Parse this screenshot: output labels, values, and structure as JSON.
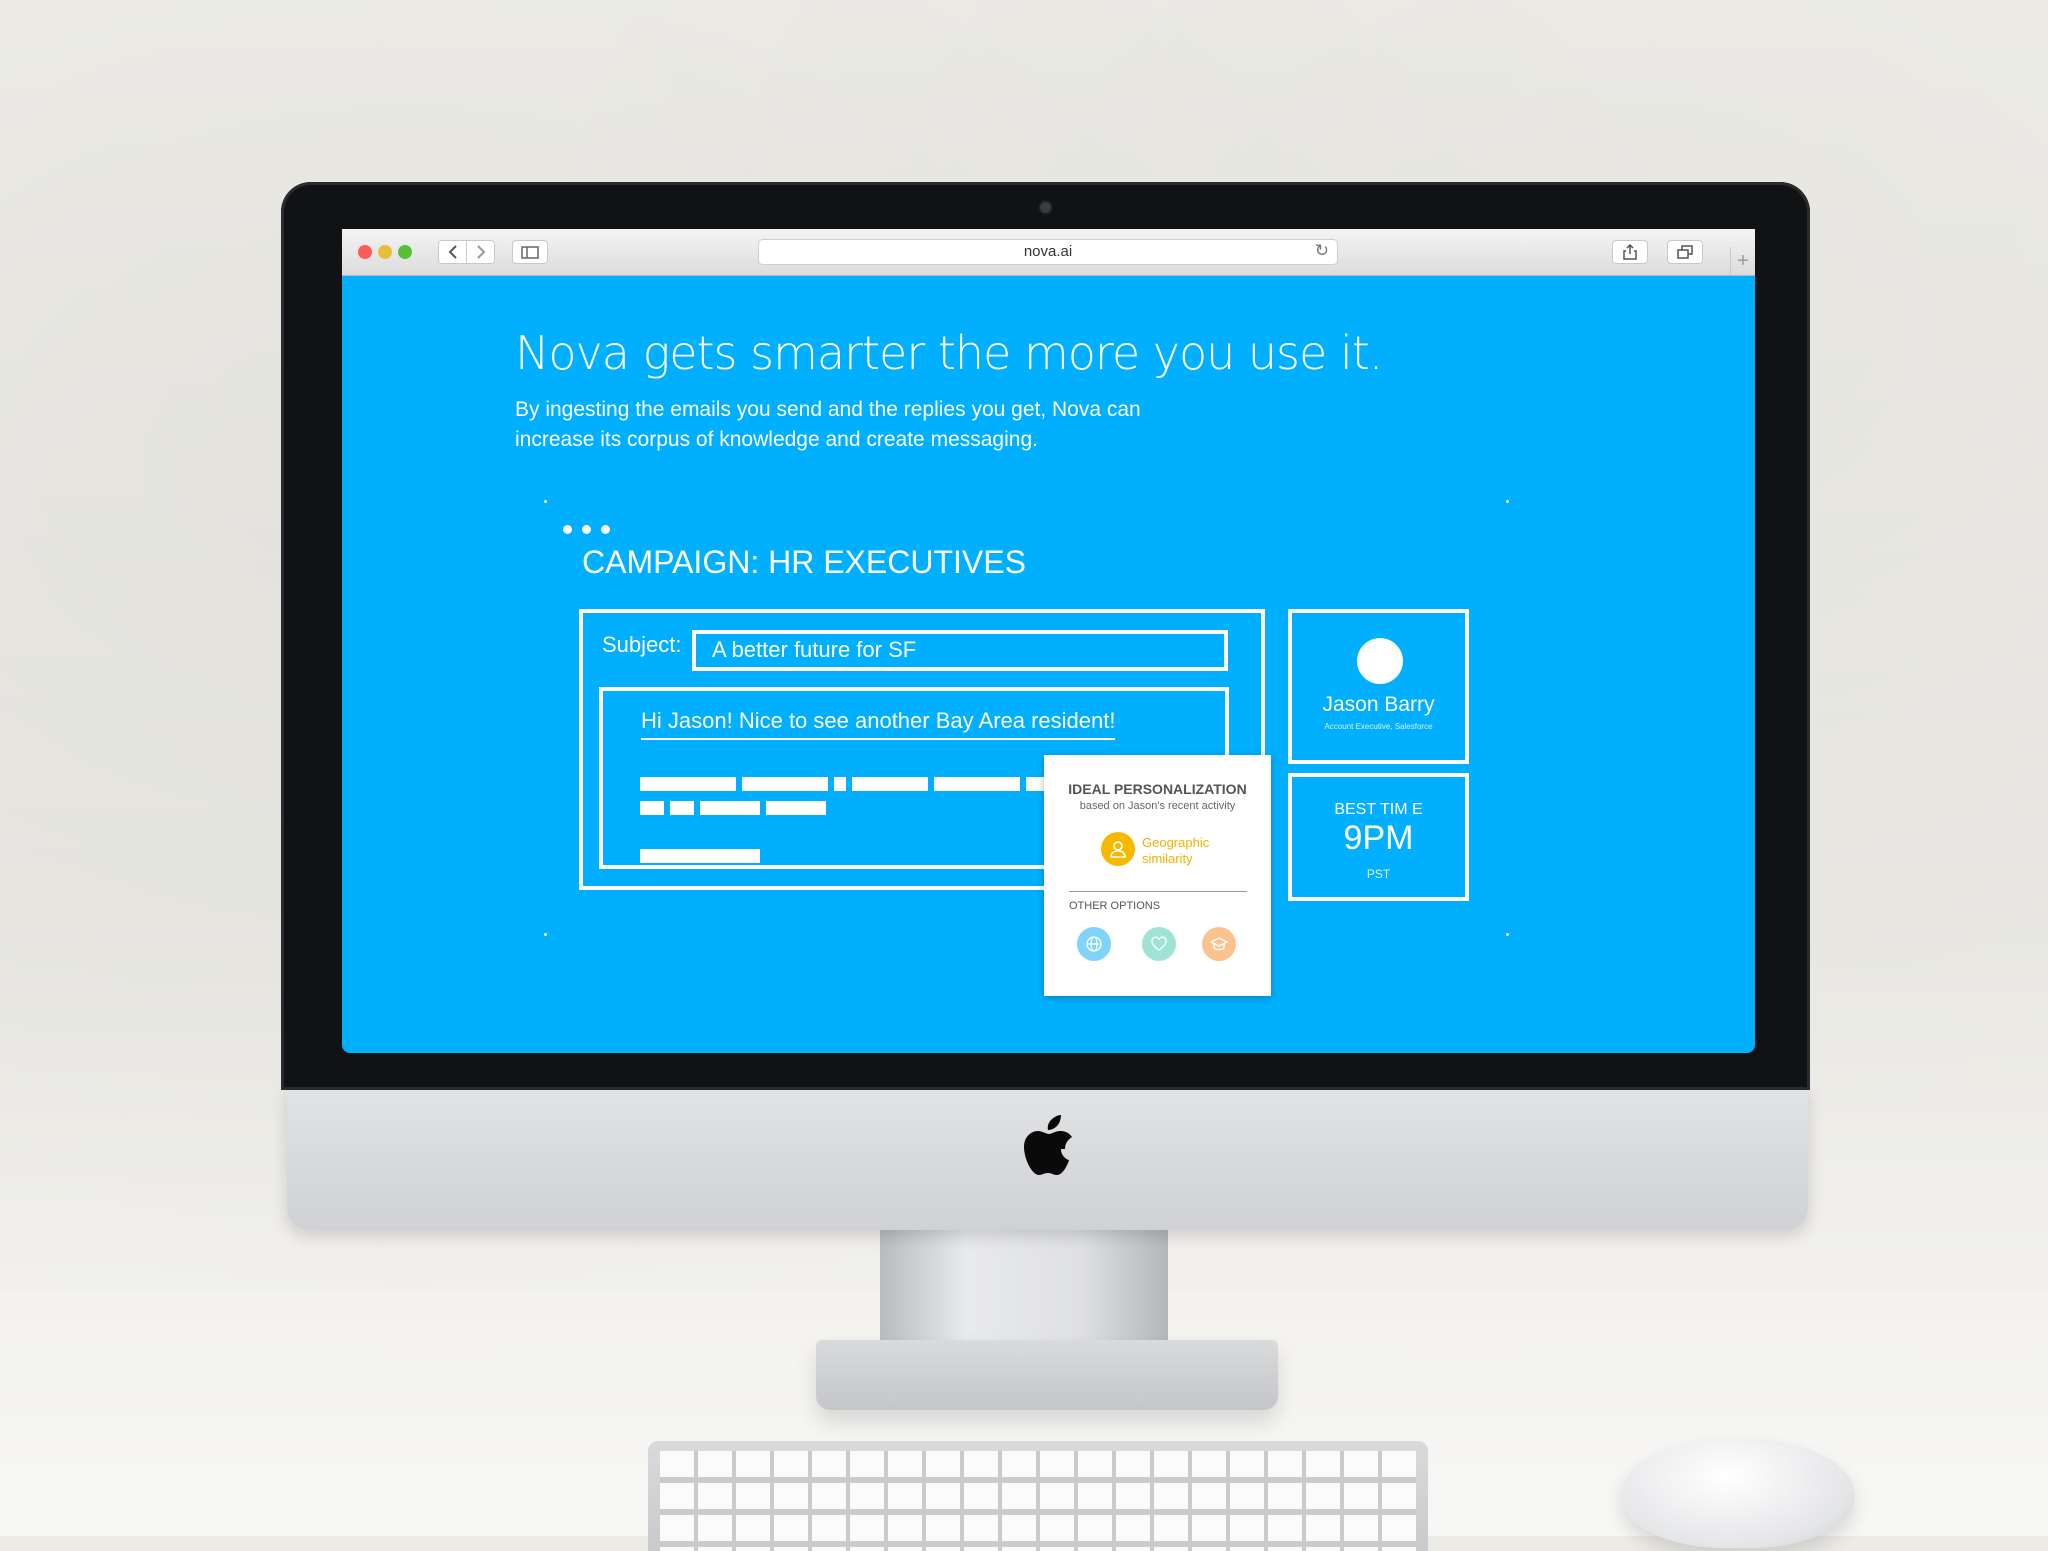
{
  "browser": {
    "url": "nova.ai"
  },
  "page": {
    "headline": "Nova gets smarter the more you use it.",
    "subline": "By ingesting the emails you send and the replies you get, Nova can increase its corpus of knowledge and create messaging."
  },
  "campaign": {
    "title": "CAMPAIGN: HR EXECUTIVES",
    "subject_label": "Subject:",
    "subject_value": "A better future for SF",
    "greeting": "Hi Jason! Nice to see another Bay Area resident!"
  },
  "popup": {
    "title": "IDEAL PERSONALIZATION",
    "subtitle": "based on Jason's recent activity",
    "primary_option": "Geographic similarity",
    "other_title": "OTHER OPTIONS"
  },
  "contact": {
    "name": "Jason Barry",
    "role": "Account Executive, Salesforce"
  },
  "best_time": {
    "label": "BEST TIM  E",
    "value": "9PM",
    "zone": "PST"
  },
  "colors": {
    "page_background": "#00b0ff",
    "accent_yellow": "#f7b900",
    "option_blue": "#7fd4f7",
    "option_green": "#9fe3d4",
    "option_orange": "#f9c28f"
  },
  "icons": [
    "back-icon",
    "forward-icon",
    "sidebar-icon",
    "reload-icon",
    "share-icon",
    "tabs-icon",
    "person-icon",
    "globe-icon",
    "heart-icon",
    "graduation-cap-icon",
    "apple-logo-icon"
  ]
}
